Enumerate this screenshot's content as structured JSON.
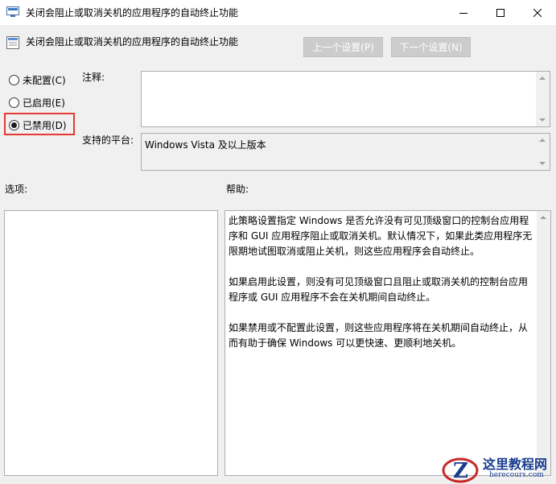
{
  "window": {
    "title": "关闭会阻止或取消关机的应用程序的自动终止功能"
  },
  "header": {
    "policy_title": "关闭会阻止或取消关机的应用程序的自动终止功能",
    "prev_label": "上一个设置(P)",
    "next_label": "下一个设置(N)"
  },
  "radios": [
    {
      "label": "未配置(C)",
      "checked": false
    },
    {
      "label": "已启用(E)",
      "checked": false
    },
    {
      "label": "已禁用(D)",
      "checked": true
    }
  ],
  "comment": {
    "label": "注释:",
    "value": ""
  },
  "platform": {
    "label": "支持的平台:",
    "value": "Windows Vista 及以上版本"
  },
  "options": {
    "label": "选项:"
  },
  "help": {
    "label": "帮助:",
    "paragraphs": [
      "此策略设置指定 Windows 是否允许没有可见顶级窗口的控制台应用程序和 GUI 应用程序阻止或取消关机。默认情况下，如果此类应用程序无限期地试图取消或阻止关机，则这些应用程序会自动终止。",
      "如果启用此设置，则没有可见顶级窗口且阻止或取消关机的控制台应用程序或 GUI 应用程序不会在关机期间自动终止。",
      "如果禁用或不配置此设置，则这些应用程序将在关机期间自动终止，从而有助于确保 Windows 可以更快速、更顺利地关机。"
    ]
  },
  "watermark": {
    "name": "这里教程网",
    "url": "herecours.com"
  },
  "colors": {
    "highlight": "#e53935",
    "disabled_button": "#cccccc",
    "watermark": "#1a3d8f"
  }
}
